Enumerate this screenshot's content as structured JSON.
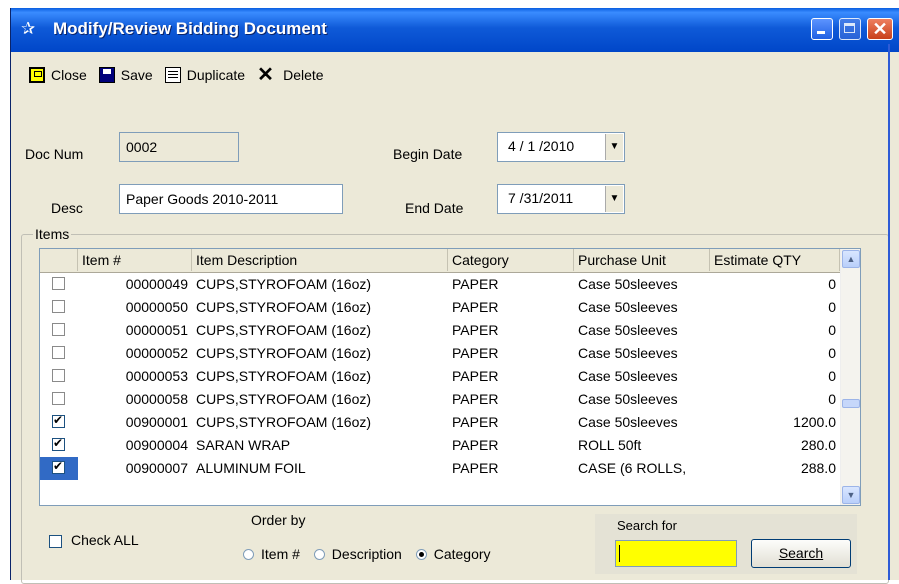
{
  "window": {
    "title": "Modify/Review Bidding Document",
    "title_icon": "document-star-icon",
    "close_glyph": "✕"
  },
  "toolbar": {
    "close_label": "Close",
    "save_label": "Save",
    "duplicate_label": "Duplicate",
    "delete_label": "Delete",
    "delete_glyph": "✕"
  },
  "form": {
    "doc_num_label": "Doc Num",
    "doc_num_value": "0002",
    "desc_label": "Desc",
    "desc_value": "Paper Goods 2010-2011",
    "begin_date_label": "Begin Date",
    "begin_date_value": "4 / 1 /2010",
    "end_date_label": "End Date",
    "end_date_value": "7 /31/2011"
  },
  "items": {
    "group_label": "Items",
    "columns": [
      "Item #",
      "Item Description",
      "Category",
      "Purchase Unit",
      "Estimate QTY"
    ],
    "rows": [
      {
        "checked": false,
        "item": "00000049",
        "desc": "CUPS,STYROFOAM (16oz)",
        "category": "PAPER",
        "unit": "Case 50sleeves",
        "qty": "0"
      },
      {
        "checked": false,
        "item": "00000050",
        "desc": "CUPS,STYROFOAM (16oz)",
        "category": "PAPER",
        "unit": "Case 50sleeves",
        "qty": "0"
      },
      {
        "checked": false,
        "item": "00000051",
        "desc": "CUPS,STYROFOAM (16oz)",
        "category": "PAPER",
        "unit": "Case 50sleeves",
        "qty": "0"
      },
      {
        "checked": false,
        "item": "00000052",
        "desc": "CUPS,STYROFOAM (16oz)",
        "category": "PAPER",
        "unit": "Case 50sleeves",
        "qty": "0"
      },
      {
        "checked": false,
        "item": "00000053",
        "desc": "CUPS,STYROFOAM (16oz)",
        "category": "PAPER",
        "unit": "Case 50sleeves",
        "qty": "0"
      },
      {
        "checked": false,
        "item": "00000058",
        "desc": "CUPS,STYROFOAM (16oz)",
        "category": "PAPER",
        "unit": "Case 50sleeves",
        "qty": "0"
      },
      {
        "checked": true,
        "item": "00900001",
        "desc": "CUPS,STYROFOAM (16oz)",
        "category": "PAPER",
        "unit": "Case 50sleeves",
        "qty": "1200.0"
      },
      {
        "checked": true,
        "item": "00900004",
        "desc": "SARAN WRAP",
        "category": "PAPER",
        "unit": "ROLL 50ft",
        "qty": "280.0"
      },
      {
        "checked": true,
        "item": "00900007",
        "desc": "ALUMINUM FOIL",
        "category": "PAPER",
        "unit": "CASE (6 ROLLS,",
        "qty": "288.0",
        "selected": true
      }
    ]
  },
  "bottom": {
    "check_all_label": "Check ALL",
    "order_by_label": "Order by",
    "order_options": [
      "Item #",
      "Description",
      "Category"
    ],
    "order_selected": "Category",
    "search_for_label": "Search for",
    "search_value": "",
    "search_button_label": "Search"
  }
}
